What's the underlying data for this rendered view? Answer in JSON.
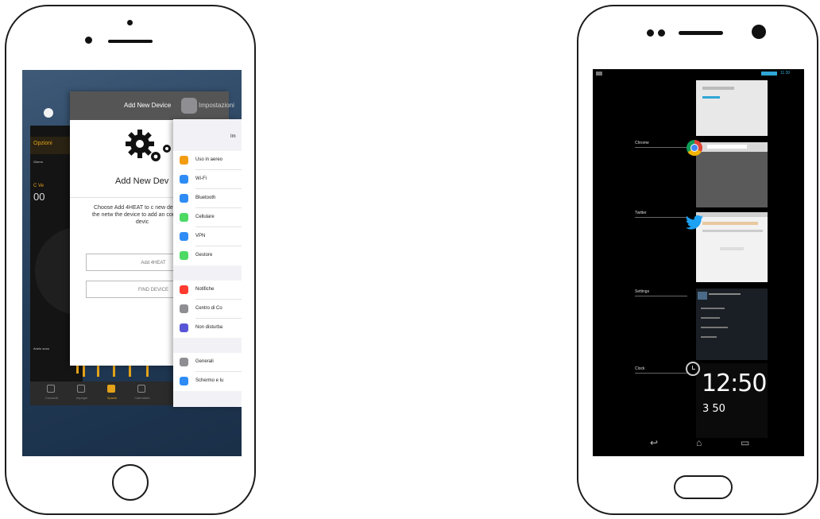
{
  "ios": {
    "thermostat_app": {
      "section_label": "Opzioni",
      "device_label": "Giorno",
      "mode_label": "C Ve",
      "time_display": "00",
      "status_label": "Anelo sono",
      "nav_items": [
        "Comandi",
        "Impegni",
        "Spazio",
        "Calendario"
      ],
      "active_nav_index": 2
    },
    "add_device": {
      "header_title": "Add New Device",
      "header_app": "Impostazioni",
      "heading": "Add New Dev",
      "description": "Choose Add 4HEAT to c new device on the netw the device to add an configured devic",
      "add_button": "Add 4HEAT",
      "find_button": "FIND DEVICE"
    },
    "settings": {
      "title": "Im",
      "rows": [
        {
          "label": "Uso in aereo",
          "color": "#f39c12"
        },
        {
          "label": "Wi-Fi",
          "color": "#2f8cf5"
        },
        {
          "label": "Bluetooth",
          "color": "#2f8cf5"
        },
        {
          "label": "Cellulare",
          "color": "#4cd964"
        },
        {
          "label": "VPN",
          "color": "#2f8cf5"
        },
        {
          "label": "Gestore",
          "color": "#4cd964"
        },
        {
          "label": "Notifiche",
          "color": "#ff3b30"
        },
        {
          "label": "Centro di Co",
          "color": "#8e8e93"
        },
        {
          "label": "Non disturba",
          "color": "#5856d6"
        },
        {
          "label": "Generali",
          "color": "#8e8e93"
        },
        {
          "label": "Schermo e lu",
          "color": "#2f8cf5"
        }
      ]
    }
  },
  "android": {
    "status_time": "11:30",
    "recent_apps": [
      {
        "label": "",
        "preview": "gallery"
      },
      {
        "label": "Chrome",
        "preview": "browser"
      },
      {
        "label": "Twitter",
        "preview": "twitter"
      },
      {
        "label": "Settings",
        "preview": "settings"
      },
      {
        "label": "Clock",
        "preview": "clock"
      }
    ],
    "clock_time": "12:50",
    "clock_temp": "3 50",
    "nav": {
      "back": "↩",
      "home": "⌂",
      "recents": "▭"
    }
  }
}
